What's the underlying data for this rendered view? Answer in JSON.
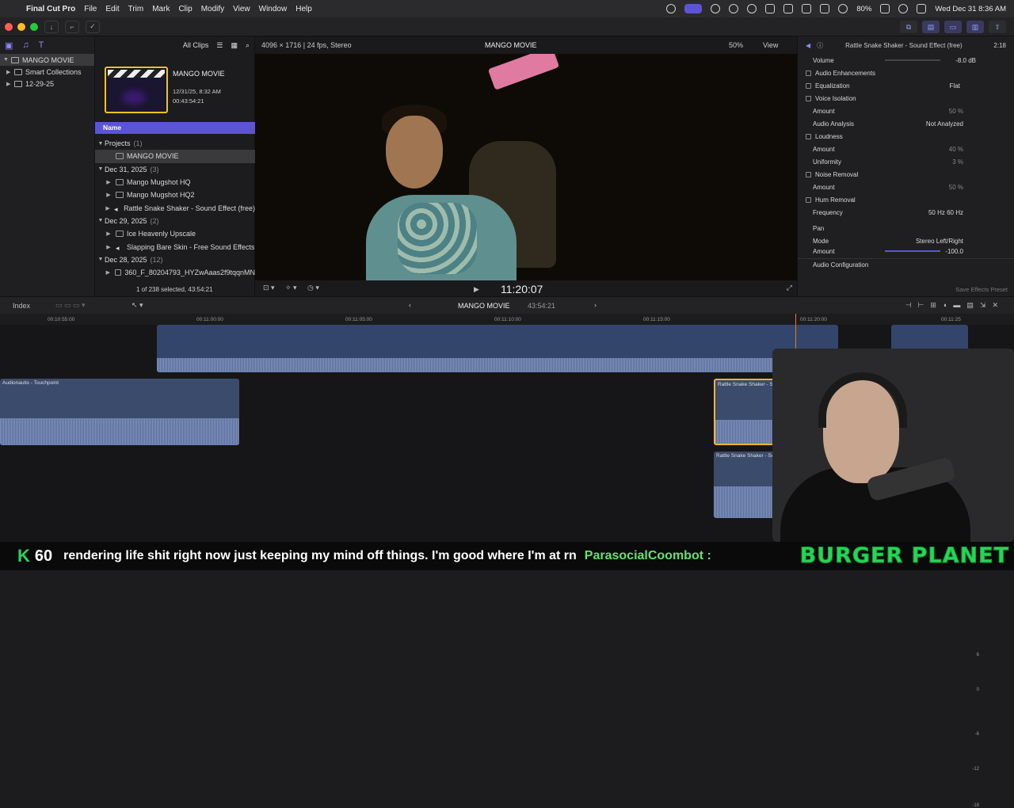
{
  "menubar": {
    "app": "Final Cut Pro",
    "items": [
      "File",
      "Edit",
      "Trim",
      "Mark",
      "Clip",
      "Modify",
      "View",
      "Window",
      "Help"
    ],
    "battery": "80%",
    "datetime": "Wed Dec 31  8:36 AM"
  },
  "browser": {
    "filter": "All Clips",
    "event_title": "MANGO MOVIE",
    "event_date": "12/31/25, 8:32 AM",
    "event_dur": "00:43:54:21",
    "name_header": "Name",
    "rows": [
      {
        "type": "group",
        "label": "Projects",
        "count": "(1)"
      },
      {
        "type": "item",
        "label": "MANGO MOVIE",
        "sel": true
      },
      {
        "type": "group",
        "label": "Dec 31, 2025",
        "count": "(3)"
      },
      {
        "type": "item",
        "label": "Mango Mugshot HQ"
      },
      {
        "type": "item",
        "label": "Mango Mugshot HQ2"
      },
      {
        "type": "item",
        "label": "Rattle Snake Shaker - Sound Effect (free)"
      },
      {
        "type": "group",
        "label": "Dec 29, 2025",
        "count": "(2)"
      },
      {
        "type": "item",
        "label": "Ice Heavenly Upscale"
      },
      {
        "type": "item",
        "label": "Slapping Bare Skin - Free Sound Effects"
      },
      {
        "type": "group",
        "label": "Dec 28, 2025",
        "count": "(12)"
      },
      {
        "type": "item",
        "label": "360_F_80204793_HYZwAaas2f9tqqnMN"
      }
    ],
    "footer": "1 of 238 selected, 43:54:21"
  },
  "library": {
    "items": [
      {
        "label": "MANGO MOVIE",
        "sel": true
      },
      {
        "label": "Smart Collections"
      },
      {
        "label": "12-29-25"
      }
    ]
  },
  "viewer": {
    "format": "4096 × 1716 | 24 fps, Stereo",
    "project": "MANGO MOVIE",
    "zoom": "50%",
    "view": "View",
    "timecode": "11:20:07"
  },
  "inspector": {
    "title": "Rattle Snake Shaker - Sound Effect (free)",
    "duration": "2:18",
    "volume_label": "Volume",
    "volume_value": "-8.0 dB",
    "section": "Audio Enhancements",
    "rows": [
      {
        "label": "Equalization",
        "chk": true,
        "value": "Flat"
      },
      {
        "label": "Voice Isolation",
        "chk": true,
        "value": ""
      },
      {
        "label": "Amount",
        "chk": false,
        "value": "50 %"
      },
      {
        "label": "Audio Analysis",
        "chk": false,
        "value": "Not Analyzed"
      },
      {
        "label": "Loudness",
        "chk": true,
        "value": ""
      },
      {
        "label": "Amount",
        "chk": false,
        "value": "40 %"
      },
      {
        "label": "Uniformity",
        "chk": false,
        "value": "3 %"
      },
      {
        "label": "Noise Removal",
        "chk": true,
        "value": ""
      },
      {
        "label": "Amount",
        "chk": false,
        "value": "50 %"
      },
      {
        "label": "Hum Removal",
        "chk": true,
        "value": ""
      },
      {
        "label": "Frequency",
        "chk": false,
        "value": "50 Hz   60 Hz"
      }
    ],
    "pan_section": "Pan",
    "mode_label": "Mode",
    "mode_value": "Stereo Left/Right",
    "pan_amount_label": "Amount",
    "pan_amount_value": "-100.0",
    "config": "Audio Configuration",
    "save_preset": "Save Effects Preset"
  },
  "timeline": {
    "index": "Index",
    "project": "MANGO MOVIE",
    "duration": "43:54:21",
    "ruler": [
      "00:10:55:00",
      "00:11:00:00",
      "00:11:05:00",
      "00:11:10:00",
      "00:11:15:00",
      "00:11:20:00",
      "00:11:25"
    ],
    "clips": [
      {
        "label": "Audionautix - Touchpoint"
      },
      {
        "label": "Rattle Snake Shaker - Sound..."
      },
      {
        "label": "Rattle Snake Shaker - Sound..."
      }
    ],
    "meter": [
      "6",
      "0",
      "-6",
      "-12",
      "-18"
    ]
  },
  "ticker": {
    "count": "60",
    "message": "rendering life shit right now just keeping my mind off things. I'm good where I'm at rn",
    "user": "ParasocialCoombot :",
    "brand": "BURGER PLANET"
  }
}
